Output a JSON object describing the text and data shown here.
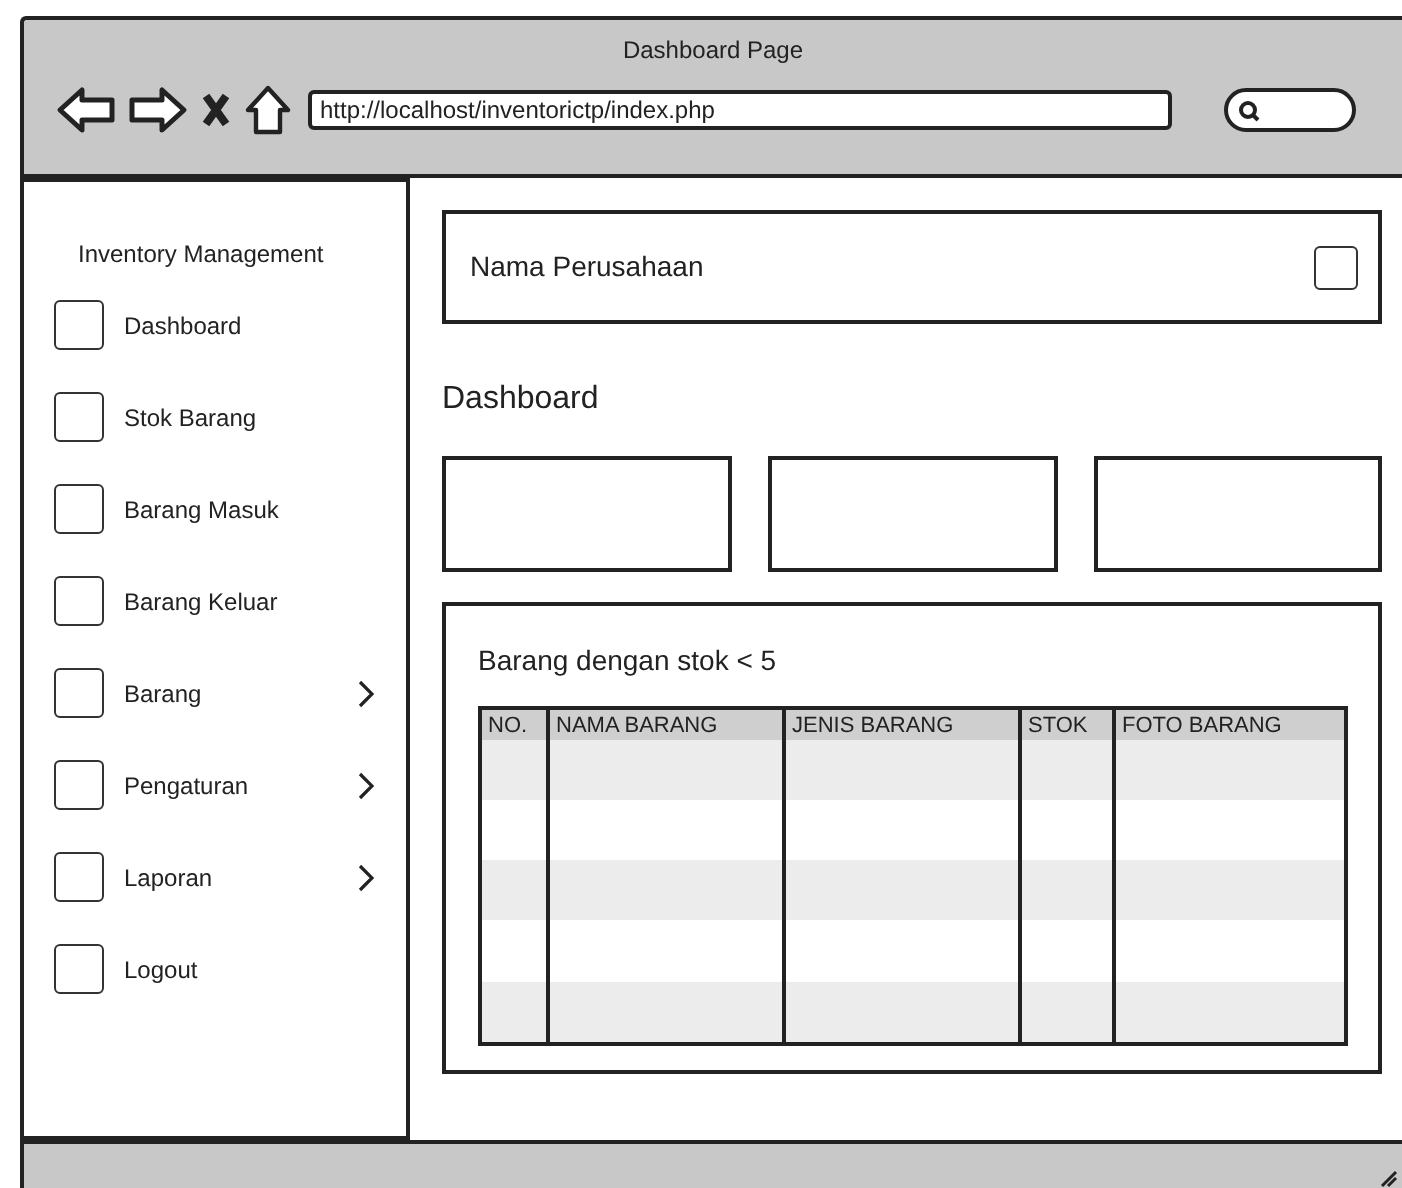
{
  "window": {
    "title": "Dashboard Page",
    "url": "http://localhost/inventorictp/index.php"
  },
  "sidebar": {
    "title": "Inventory Management",
    "items": [
      {
        "label": "Dashboard",
        "expandable": false
      },
      {
        "label": "Stok Barang",
        "expandable": false
      },
      {
        "label": "Barang Masuk",
        "expandable": false
      },
      {
        "label": "Barang Keluar",
        "expandable": false
      },
      {
        "label": "Barang",
        "expandable": true
      },
      {
        "label": "Pengaturan",
        "expandable": true
      },
      {
        "label": "Laporan",
        "expandable": true
      },
      {
        "label": "Logout",
        "expandable": false
      }
    ]
  },
  "header": {
    "company": "Nama Perusahaan"
  },
  "page_title": "Dashboard",
  "low_stock": {
    "title": "Barang dengan stok < 5",
    "columns": [
      "NO.",
      "NAMA BARANG",
      "JENIS BARANG",
      "STOK",
      "FOTO BARANG"
    ]
  }
}
